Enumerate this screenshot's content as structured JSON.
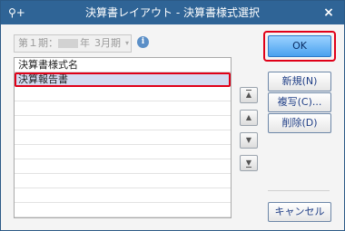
{
  "window": {
    "title": "決算書レイアウト - 決算書様式選択",
    "pin_icon": "pin-plus-icon",
    "close_icon": "close-icon",
    "close_glyph": "×",
    "pin_glyph": "⚲+"
  },
  "period": {
    "prefix": "第１期：",
    "year_suffix": "年",
    "month": "3月期",
    "info_icon": "info-icon",
    "info_glyph": "i",
    "dropdown_glyph": "▾"
  },
  "list": {
    "header": "決算書様式名",
    "items": [
      "決算報告書"
    ],
    "selected_index": 0,
    "empty_rows": 9
  },
  "move_buttons": {
    "top": "▲",
    "up": "▲",
    "down": "▼",
    "bottom": "▼"
  },
  "buttons": {
    "ok": "OK",
    "new": "新規(N)",
    "copy": "複写(C)...",
    "delete": "削除(D)",
    "cancel": "キャンセル"
  },
  "colors": {
    "titlebar": "#2f6496",
    "highlight": "#e00018",
    "ok_button": "#4aa1ef",
    "selected_row": "#d3dbf1"
  }
}
